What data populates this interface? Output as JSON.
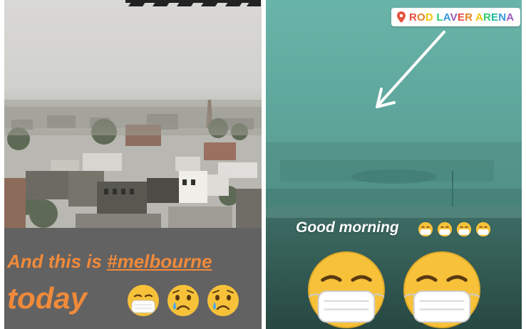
{
  "left_story": {
    "caption_line1_prefix": "And this is ",
    "caption_hashtag": "#melbourne",
    "caption_line2": "today",
    "emojis": [
      "face-with-medical-mask-icon",
      "crying-face-icon",
      "crying-face-icon"
    ]
  },
  "right_story": {
    "location_sticker": "ROD LAVER ARENA",
    "location_letter_colors": [
      "#e74c3c",
      "#e67e22",
      "#f1c40f",
      "#2ecc71",
      "#3498db",
      "#9b59b6",
      "#e74c3c",
      "#e67e22",
      "#f1c40f",
      "#2ecc71",
      "#1abc9c",
      "#3498db",
      "#9b59b6",
      "#e84393",
      "#e74c3c"
    ],
    "greeting": "Good morning",
    "small_emojis": [
      "face-with-medical-mask-icon",
      "face-with-medical-mask-icon",
      "face-with-medical-mask-icon",
      "face-with-medical-mask-icon"
    ],
    "large_emojis": [
      "face-with-medical-mask-icon",
      "face-with-medical-mask-icon"
    ]
  },
  "colors": {
    "caption_orange": "#f08a3a",
    "caption_strip": "#636262",
    "smoke_teal": "#5fa79c"
  }
}
